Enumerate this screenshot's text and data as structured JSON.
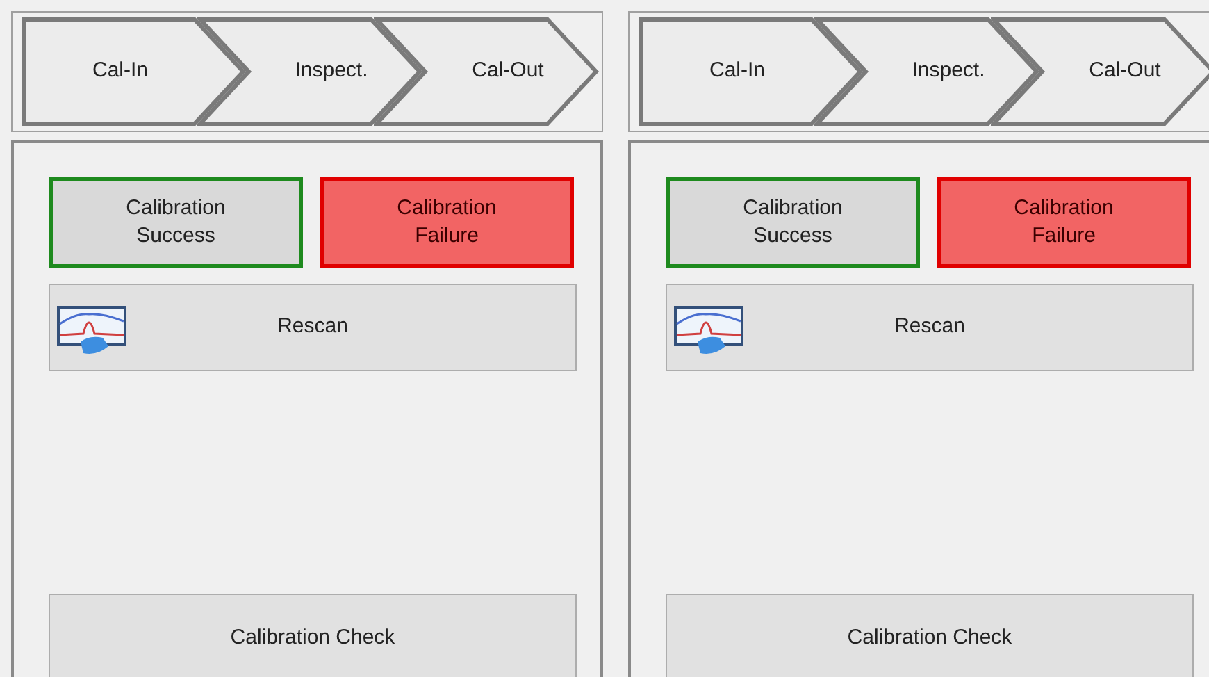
{
  "panels": [
    {
      "steps": [
        "Cal-In",
        "Inspect.",
        "Cal-Out"
      ],
      "buttons": [
        {
          "kind": "success",
          "label": "Calibration Success"
        },
        {
          "kind": "failure",
          "label": "Calibration Failure"
        },
        {
          "kind": "rescan",
          "label": "Rescan"
        },
        {
          "kind": "check",
          "label": "Calibration Check"
        }
      ]
    },
    {
      "steps": [
        "Cal-In",
        "Inspect.",
        "Cal-Out"
      ],
      "buttons": [
        {
          "kind": "success",
          "label": "Calibration Success"
        },
        {
          "kind": "failure",
          "label": "Calibration Failure"
        },
        {
          "kind": "rescan",
          "label": "Rescan"
        },
        {
          "kind": "check",
          "label": "Calibration Check"
        }
      ]
    }
  ]
}
